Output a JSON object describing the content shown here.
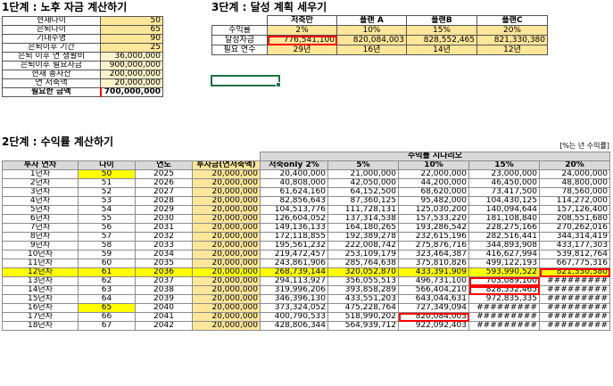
{
  "step1": {
    "title": "1단계 : 노후 자금 계산하기",
    "rows": [
      {
        "label": "현재나이",
        "value": "50"
      },
      {
        "label": "은퇴나이",
        "value": "65"
      },
      {
        "label": "기대수명",
        "value": "90"
      },
      {
        "label": "은퇴이후 기간",
        "value": "25"
      },
      {
        "label": "은퇴 이후 연 생활비",
        "value": "36,000,000"
      },
      {
        "label": "은퇴이후 필요자금",
        "value": "900,000,000"
      },
      {
        "label": "현재 총자산",
        "value": "200,000,000"
      },
      {
        "label": "연 저축액",
        "value": "20,000,000"
      },
      {
        "label": "필요한 금액",
        "value": "700,000,000"
      }
    ]
  },
  "step3": {
    "title": "3단계 : 달성 계획 세우기",
    "headers": [
      "",
      "저축만",
      "플랜 A",
      "플랜B",
      "플랜C"
    ],
    "rows": [
      {
        "label": "수익률",
        "values": [
          "2%",
          "10%",
          "15%",
          "20%"
        ]
      },
      {
        "label": "달성자금",
        "values": [
          "776,541,100",
          "820,084,003",
          "828,552,465",
          "821,330,380"
        ]
      },
      {
        "label": "필요 연수",
        "values": [
          "29년",
          "16년",
          "14년",
          "12년"
        ]
      }
    ]
  },
  "step2": {
    "title": "2단계 : 수익률 계산하기",
    "note": "[%는 년 수익률]",
    "scenario_header": "수익률 시나리오",
    "columns": [
      "투자 연차",
      "나이",
      "연도",
      "투자금(연저축액)",
      "저축only 2%",
      "5%",
      "10%",
      "15%",
      "20%"
    ],
    "rows": [
      [
        "1년차",
        "50",
        "2025",
        "20,000,000",
        "20,400,000",
        "21,000,000",
        "22,000,000",
        "23,000,000",
        "24,000,000"
      ],
      [
        "2년차",
        "51",
        "2026",
        "20,000,000",
        "40,808,000",
        "42,050,000",
        "44,200,000",
        "46,450,000",
        "48,800,000"
      ],
      [
        "3년차",
        "52",
        "2027",
        "20,000,000",
        "61,624,160",
        "64,152,500",
        "68,620,000",
        "73,417,500",
        "78,560,000"
      ],
      [
        "4년차",
        "53",
        "2028",
        "20,000,000",
        "82,856,643",
        "87,360,125",
        "95,482,000",
        "104,430,125",
        "114,272,000"
      ],
      [
        "5년차",
        "54",
        "2029",
        "20,000,000",
        "104,513,776",
        "111,728,131",
        "125,030,200",
        "140,094,644",
        "157,126,400"
      ],
      [
        "6년차",
        "55",
        "2030",
        "20,000,000",
        "126,604,052",
        "137,314,538",
        "157,533,220",
        "181,108,840",
        "208,551,680"
      ],
      [
        "7년차",
        "56",
        "2031",
        "20,000,000",
        "149,136,133",
        "164,180,265",
        "193,286,542",
        "228,275,166",
        "270,262,016"
      ],
      [
        "8년차",
        "57",
        "2032",
        "20,000,000",
        "172,118,855",
        "192,389,278",
        "232,615,196",
        "282,516,441",
        "344,314,419"
      ],
      [
        "9년차",
        "58",
        "2033",
        "20,000,000",
        "195,561,232",
        "222,008,742",
        "275,876,716",
        "344,893,908",
        "433,177,303"
      ],
      [
        "10년차",
        "59",
        "2034",
        "20,000,000",
        "219,472,457",
        "253,109,179",
        "323,464,387",
        "416,627,994",
        "539,812,764"
      ],
      [
        "11년차",
        "60",
        "2035",
        "20,000,000",
        "243,861,906",
        "285,764,638",
        "375,810,826",
        "499,122,193",
        "667,775,316"
      ],
      [
        "12년차",
        "61",
        "2036",
        "20,000,000",
        "268,739,144",
        "320,052,870",
        "433,391,909",
        "593,990,522",
        "821,330,380"
      ],
      [
        "13년차",
        "62",
        "2037",
        "20,000,000",
        "294,113,927",
        "356,055,513",
        "496,731,100",
        "703,089,100",
        "#########"
      ],
      [
        "14년차",
        "63",
        "2038",
        "20,000,000",
        "319,996,206",
        "393,858,289",
        "566,404,210",
        "828,552,465",
        "#########"
      ],
      [
        "15년차",
        "64",
        "2039",
        "20,000,000",
        "346,396,130",
        "433,551,203",
        "643,044,631",
        "972,835,335",
        "#########"
      ],
      [
        "16년차",
        "65",
        "2040",
        "20,000,000",
        "373,324,052",
        "475,228,764",
        "727,349,094",
        "#########",
        "#########"
      ],
      [
        "17년차",
        "66",
        "2041",
        "20,000,000",
        "400,790,533",
        "518,990,202",
        "820,084,003",
        "#########",
        "#########"
      ],
      [
        "18년차",
        "67",
        "2042",
        "20,000,000",
        "428,806,344",
        "564,939,712",
        "922,092,403",
        "#########",
        "#########"
      ]
    ]
  },
  "colors": {
    "yellow": "#ffff00",
    "light_yellow": "#ffe699",
    "red": "#ff0000",
    "selection": "#1e7145"
  }
}
